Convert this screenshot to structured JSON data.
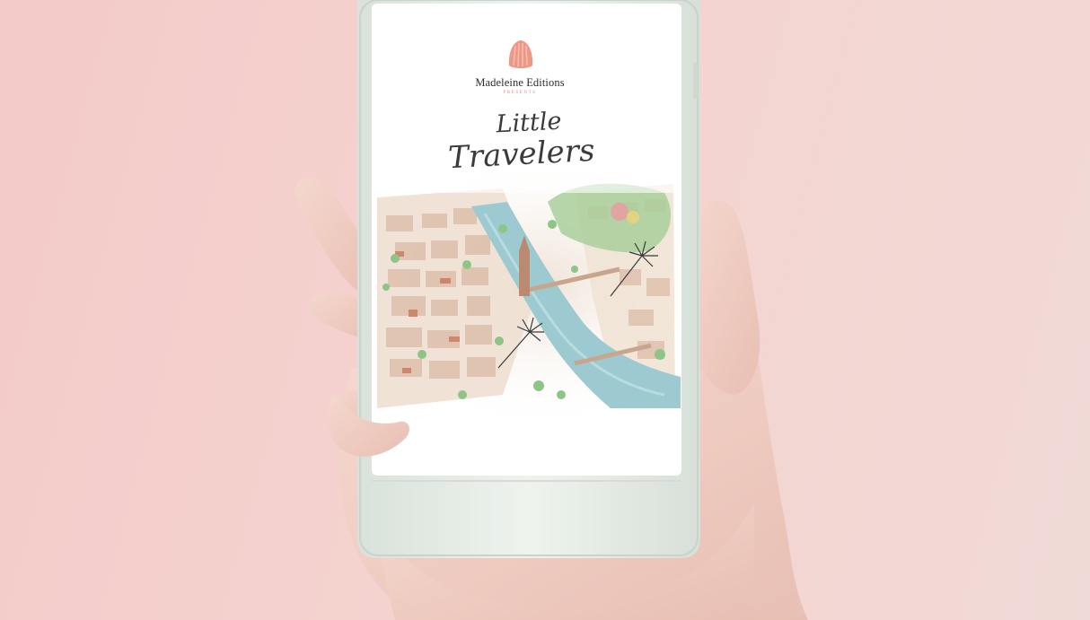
{
  "app_screen": {
    "brand_name": "Madeleine Editions",
    "brand_sub": "PRESENTS",
    "title_line1": "Little",
    "title_line2": "Travelers",
    "logo_icon": "madeleine-shell-icon"
  },
  "colors": {
    "background_pink": "#f3cdca",
    "phone_body": "#e3ebe3",
    "screen_white": "#ffffff",
    "river_blue": "#9ccad0",
    "logo_coral": "#ef9787"
  }
}
